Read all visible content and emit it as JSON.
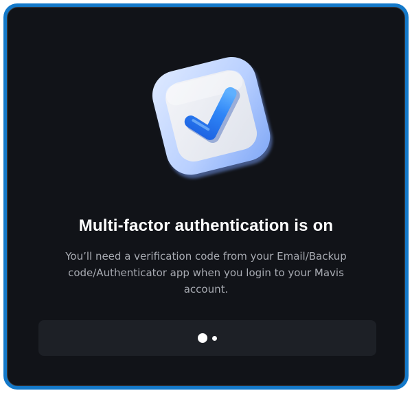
{
  "dialog": {
    "illustration_icon": "checkmark-badge-icon",
    "title": "Multi-factor authentication is on",
    "description": "You’ll need a verification code from your Email/Backup code/Authenticator app when you login to your Mavis account.",
    "button_state": "loading",
    "loading_icon": "loading-dots-icon"
  },
  "colors": {
    "frame_accent": "#1479c9",
    "dialog_background": "#111318",
    "button_background": "#1d2026",
    "title_text": "#ffffff",
    "body_text": "#a7aab1",
    "check_blue": "#1f6ff2"
  }
}
